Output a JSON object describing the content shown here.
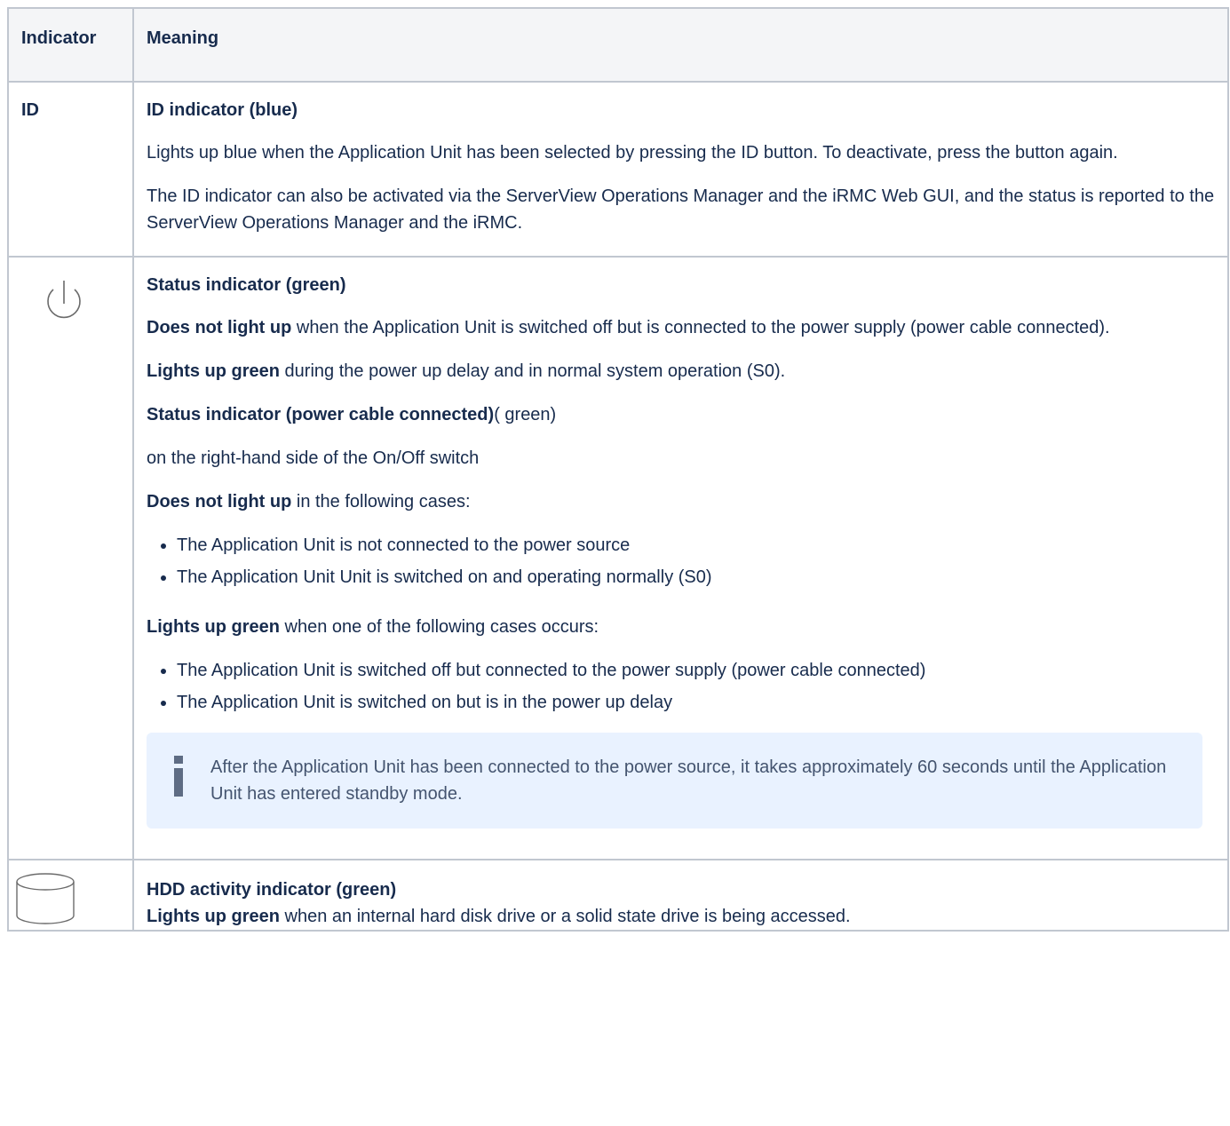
{
  "table": {
    "headers": {
      "indicator": "Indicator",
      "meaning": "Meaning"
    },
    "rows": [
      {
        "indicator": "ID",
        "title": "ID indicator (blue)",
        "paragraphs": [
          "Lights up blue when the Application Unit has been selected by pressing the ID button. To deactivate, press the button again.",
          "The ID indicator can also be activated via the ServerView Operations Manager and the iRMC Web GUI, and the status is reported to the ServerView Operations Manager and the iRMC."
        ]
      },
      {
        "indicator_icon": "power-icon",
        "title": "Status indicator (green)",
        "p1_bold": "Does not light up",
        "p1_rest": " when the Application Unit is switched off but is connected to the power supply (power cable connected).",
        "p2_bold": "Lights up green",
        "p2_rest": " during the power up delay and in normal system operation (S0).",
        "p3_bold": "Status indicator (power cable connected)",
        "p3_rest": "( green)",
        "p4": "on the right-hand side of the On/Off switch",
        "p5_bold": "Does not light up",
        "p5_rest": " in the following cases:",
        "list1": [
          "The Application Unit is not connected to the power source",
          "The Application Unit Unit is switched on and operating normally (S0)"
        ],
        "p6_bold": "Lights up green",
        "p6_rest": " when one of the following cases occurs:",
        "list2": [
          "The Application Unit is switched off but connected to the power supply (power cable connected)",
          "The Application Unit is switched on but is in the power up delay"
        ],
        "info_icon": "info-icon",
        "info_text": "After the Application Unit has been connected to the power source, it takes approximately 60 seconds until the Application Unit has entered standby mode."
      },
      {
        "indicator_icon": "hdd-icon",
        "title": "HDD activity indicator (green)",
        "p1_bold": "Lights up green",
        "p1_rest": " when an internal hard disk drive or a solid state drive is being accessed."
      }
    ]
  },
  "colors": {
    "border": "#c1c7d0",
    "header_bg": "#f4f5f7",
    "info_bg": "#e9f2ff",
    "text": "#172b4d"
  }
}
